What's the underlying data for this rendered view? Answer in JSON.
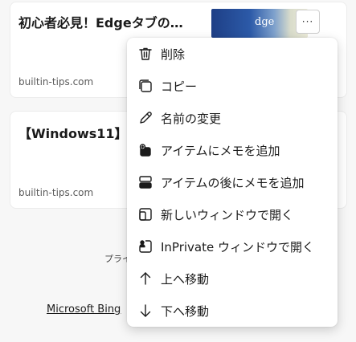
{
  "cards": [
    {
      "title": "初心者必見！Edgeタブの…",
      "source": "builtin-tips.com",
      "thumb_text": "dge"
    },
    {
      "title": "【Windows11】Ed",
      "source": "builtin-tips.com"
    }
  ],
  "more_button": "···",
  "background": {
    "privacy": "プライ",
    "bing": "Microsoft Bing"
  },
  "menu": {
    "items": [
      {
        "label": "削除",
        "icon": "trash-icon"
      },
      {
        "label": "コピー",
        "icon": "copy-icon"
      },
      {
        "label": "名前の変更",
        "icon": "pencil-icon"
      },
      {
        "label": "アイテムにメモを追加",
        "icon": "note-add-icon"
      },
      {
        "label": "アイテムの後にメモを追加",
        "icon": "note-after-icon"
      },
      {
        "label": "新しいウィンドウで開く",
        "icon": "new-window-icon"
      },
      {
        "label": "InPrivate ウィンドウで開く",
        "icon": "inprivate-window-icon"
      },
      {
        "label": "上へ移動",
        "icon": "arrow-up-icon"
      },
      {
        "label": "下へ移動",
        "icon": "arrow-down-icon"
      }
    ]
  }
}
